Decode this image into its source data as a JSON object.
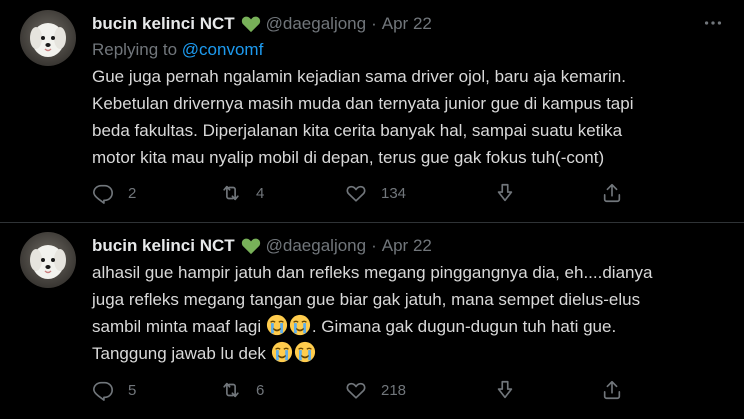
{
  "tweets": [
    {
      "name": "bucin kelinci NCT",
      "handle": "@daegaljong",
      "separator": "·",
      "date": "Apr 22",
      "replying_prefix": "Replying to",
      "replying_to": "@convomf",
      "text": "Gue juga pernah ngalamin kejadian sama driver ojol, baru aja kemarin.\nKebetulan drivernya masih muda dan ternyata junior gue di kampus tapi\nbeda fakultas. Diperjalanan kita cerita banyak hal, sampai suatu ketika\nmotor kita mau nyalip mobil di depan, terus gue gak fokus tuh(-cont)",
      "replies": "2",
      "retweets": "4",
      "likes": "134"
    },
    {
      "name": "bucin kelinci NCT",
      "handle": "@daegaljong",
      "separator": "·",
      "date": "Apr 22",
      "text_lines": [
        "alhasil gue hampir jatuh dan refleks megang pinggangnya dia, eh....dianya",
        "juga refleks megang tangan gue biar gak jatuh, mana sempet dielus-elus",
        "sambil minta maaf lagi",
        ". Gimana gak dugun-dugun tuh hati gue.",
        "Tanggung jawab lu dek"
      ],
      "replies": "5",
      "retweets": "6",
      "likes": "218"
    }
  ],
  "icons": {
    "verified_heart": "green-heart-icon",
    "more": "more-icon",
    "reply": "reply-icon",
    "retweet": "retweet-icon",
    "like": "like-icon",
    "download": "download-icon",
    "share": "share-icon",
    "emoji": "loudly-crying-face-emoji"
  },
  "colors": {
    "background": "#000000",
    "text": "#d9d9d9",
    "muted": "#71767b",
    "link": "#1d9bf0",
    "heart": "#78b159"
  }
}
